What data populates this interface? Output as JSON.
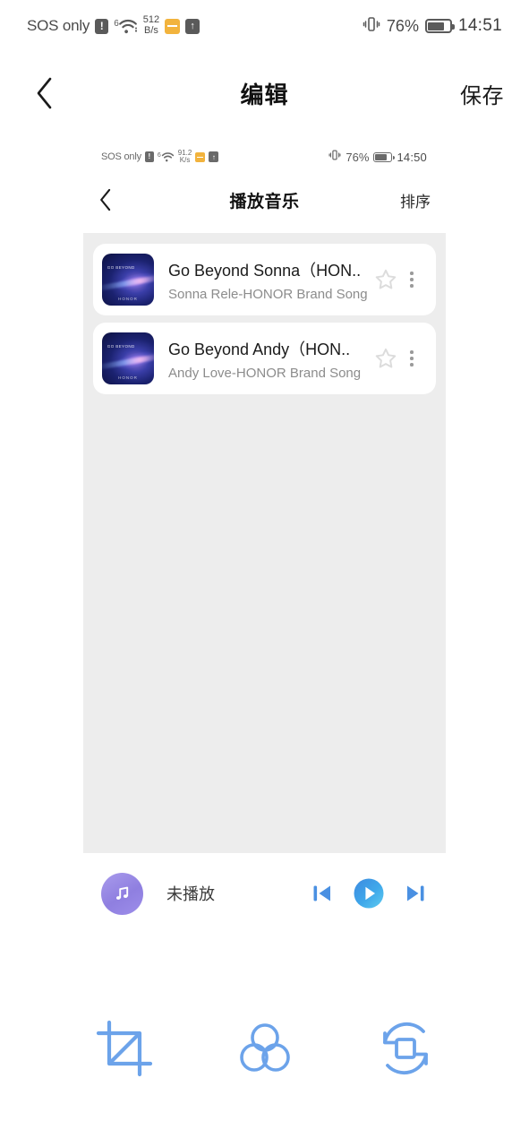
{
  "outer_status": {
    "carrier": "SOS only",
    "warning_glyph": "!",
    "wifi_gen": "6",
    "net_speed_value": "512",
    "net_speed_unit": "B/s",
    "upload_glyph": "↑",
    "battery_percent": "76%",
    "battery_level": 76,
    "time": "14:51"
  },
  "header": {
    "back_label": "‹",
    "title": "编辑",
    "save_label": "保存"
  },
  "inner_status": {
    "carrier": "SOS only",
    "warning_glyph": "!",
    "wifi_gen": "6",
    "net_speed_value": "91.2",
    "net_speed_unit": "K/s",
    "upload_glyph": "↑",
    "battery_percent": "76%",
    "battery_level": 76,
    "time": "14:50"
  },
  "inner_header": {
    "back_label": "‹",
    "title": "播放音乐",
    "sort_label": "排序"
  },
  "songs": [
    {
      "title": "Go Beyond Sonna（HON..",
      "artist": "Sonna Rele-HONOR Brand Song",
      "art_top_text": "GO BEYOND",
      "art_bottom_text": "HONOR",
      "favorited": false
    },
    {
      "title": "Go Beyond Andy（HON..",
      "artist": "Andy Love-HONOR Brand Song",
      "art_top_text": "GO BEYOND",
      "art_bottom_text": "HONOR",
      "favorited": false
    }
  ],
  "player": {
    "status_label": "未播放",
    "prev_icon": "skip-previous-icon",
    "play_icon": "play-icon",
    "next_icon": "skip-next-icon"
  },
  "toolbar": {
    "items": [
      {
        "icon": "crop-icon"
      },
      {
        "icon": "color-filter-icon"
      },
      {
        "icon": "rotate-transform-icon"
      }
    ]
  },
  "colors": {
    "accent_blue": "#6ca3ea",
    "play_blue": "#3f8fe0",
    "note_purple": "#9b8ae6",
    "panel_gray": "#ededed",
    "card_white": "#ffffff",
    "title_text": "#1b1b1b",
    "artist_text": "#8c8c8c",
    "star_gray": "#dcdcdc"
  }
}
